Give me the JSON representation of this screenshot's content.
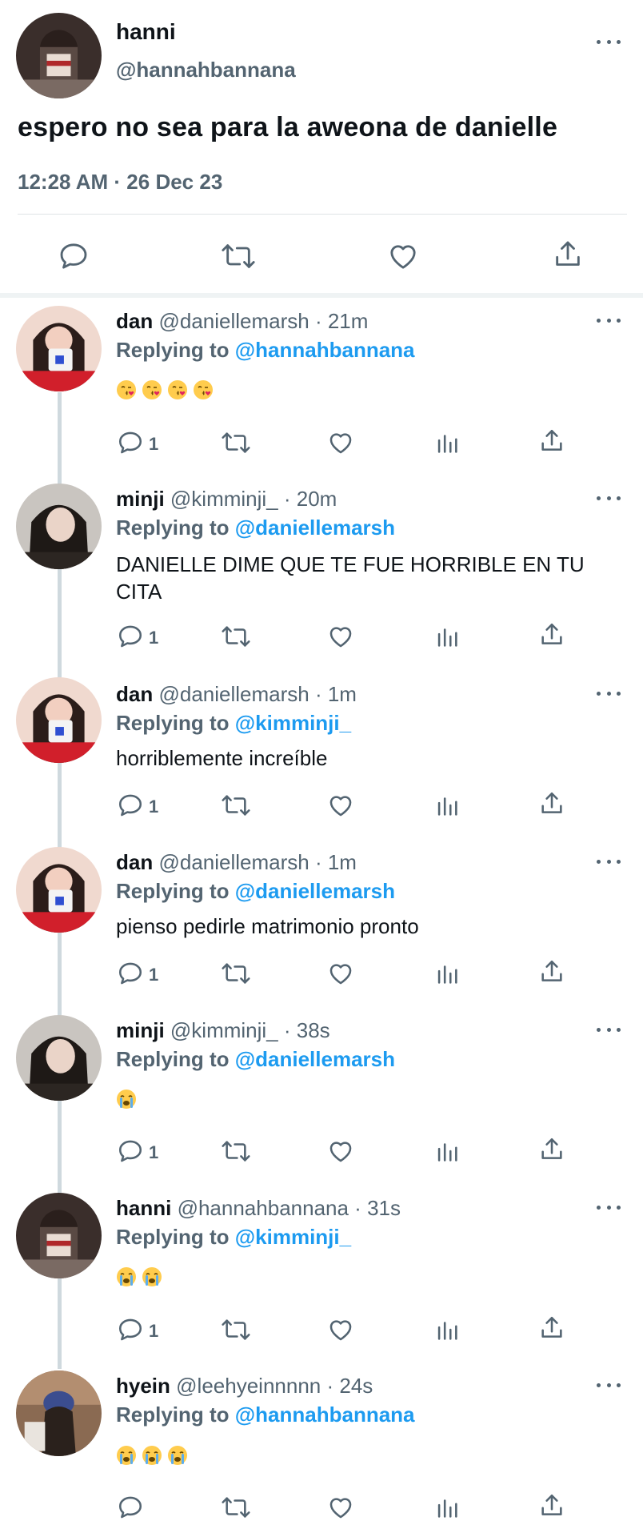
{
  "main_tweet": {
    "name": "hanni",
    "handle": "@hannahbannana",
    "text": "espero no sea para la aweona de danielle",
    "timestamp": "12:28 AM · 26 Dec 23",
    "actions": [
      "reply-icon",
      "retweet-icon",
      "like-icon",
      "share-icon"
    ]
  },
  "replies": [
    {
      "name": "dan",
      "handle": "@daniellemarsh",
      "time": "21m",
      "replying_label": "Replying to",
      "replying_to": "@hannahbannana",
      "text": "",
      "emoji": [
        "face-blowing-kiss",
        "face-blowing-kiss",
        "face-blowing-kiss",
        "face-blowing-kiss"
      ],
      "reply_count": "1"
    },
    {
      "name": "minji",
      "handle": "@kimminji_",
      "time": "20m",
      "replying_label": "Replying to",
      "replying_to": "@daniellemarsh",
      "text": "DANIELLE DIME QUE TE FUE HORRIBLE EN TU CITA",
      "emoji": [],
      "reply_count": "1"
    },
    {
      "name": "dan",
      "handle": "@daniellemarsh",
      "time": "1m",
      "replying_label": "Replying to",
      "replying_to": "@kimminji_",
      "text": "horriblemente increíble",
      "emoji": [],
      "reply_count": "1"
    },
    {
      "name": "dan",
      "handle": "@daniellemarsh",
      "time": "1m",
      "replying_label": "Replying to",
      "replying_to": "@daniellemarsh",
      "text": "pienso pedirle matrimonio pronto",
      "emoji": [],
      "reply_count": "1"
    },
    {
      "name": "minji",
      "handle": "@kimminji_",
      "time": "38s",
      "replying_label": "Replying to",
      "replying_to": "@daniellemarsh",
      "text": "",
      "emoji": [
        "loudly-crying-face"
      ],
      "reply_count": "1"
    },
    {
      "name": "hanni",
      "handle": "@hannahbannana",
      "time": "31s",
      "replying_label": "Replying to",
      "replying_to": "@kimminji_",
      "text": "",
      "emoji": [
        "loudly-crying-face",
        "loudly-crying-face"
      ],
      "reply_count": "1"
    },
    {
      "name": "hyein",
      "handle": "@leehyeinnnnn",
      "time": "24s",
      "replying_label": "Replying to",
      "replying_to": "@hannahbannana",
      "text": "",
      "emoji": [
        "loudly-crying-face",
        "loudly-crying-face",
        "loudly-crying-face"
      ],
      "reply_count": ""
    }
  ],
  "colors": {
    "accent": "#1d9bf0",
    "muted": "#536471",
    "text": "#0f1419",
    "divider": "#eff3f4"
  }
}
